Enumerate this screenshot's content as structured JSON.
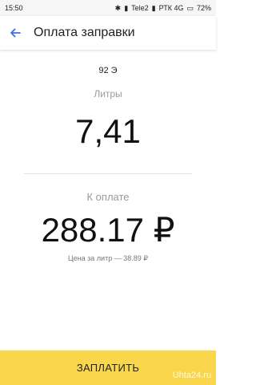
{
  "status_bar": {
    "time": "15:50",
    "carrier1": "Tele2",
    "carrier2": "РТК 4G",
    "battery": "72%"
  },
  "header": {
    "title": "Оплата заправки"
  },
  "fuel": {
    "type": "92 Э",
    "liters_label": "Литры",
    "liters_value": "7,41"
  },
  "payment": {
    "label": "К оплате",
    "amount": "288.17 ₽",
    "price_per_liter": "Цена за литр — 38.89 ₽"
  },
  "pay_button": {
    "label": "ЗАПЛАТИТЬ"
  },
  "watermark": "Uhta24.ru",
  "colors": {
    "accent": "#3d6fe0",
    "button": "#f9d64b"
  }
}
